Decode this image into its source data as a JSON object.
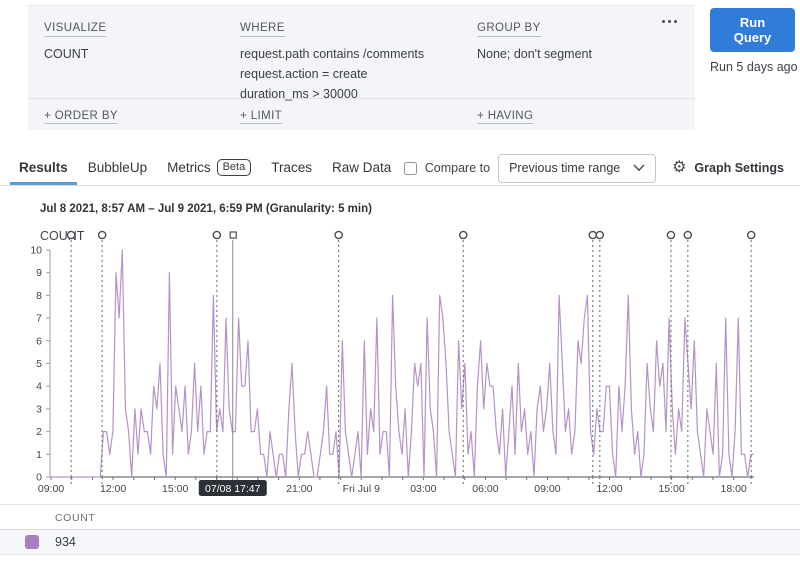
{
  "query_builder": {
    "visualize": {
      "label": "VISUALIZE",
      "value": "COUNT"
    },
    "where": {
      "label": "WHERE",
      "clauses": [
        "request.path contains /comments",
        "request.action = create",
        "duration_ms > 30000"
      ]
    },
    "group_by": {
      "label": "GROUP BY",
      "value": "None; don't segment"
    },
    "order_by_label": "+ ORDER BY",
    "limit_label": "+ LIMIT",
    "having_label": "+ HAVING",
    "run_button_label": "Run Query",
    "last_run_text": "Run 5 days ago"
  },
  "tabs": [
    {
      "label": "Results",
      "active": true
    },
    {
      "label": "BubbleUp",
      "active": false
    },
    {
      "label": "Metrics",
      "badge": "Beta",
      "active": false
    },
    {
      "label": "Traces",
      "active": false
    },
    {
      "label": "Raw Data",
      "active": false
    }
  ],
  "toolbar": {
    "compare_label": "Compare to",
    "compare_checked": false,
    "range_select_value": "Previous time range",
    "gear_glyph": "⚙",
    "graph_settings_label": "Graph Settings"
  },
  "chart_data": {
    "type": "line",
    "title": "Jul 8 2021, 8:57 AM – Jul 9 2021, 6:59 PM (Granularity: 5 min)",
    "ylabel": "COUNT",
    "ylim": [
      0,
      10
    ],
    "y_ticks": [
      0,
      1,
      2,
      3,
      4,
      5,
      6,
      7,
      8,
      9,
      10
    ],
    "x_range_minutes": 2042,
    "x_tick_interval_minutes": 60,
    "x_ticks": [
      {
        "label": "09:00",
        "f": 0.0015
      },
      {
        "label": "12:00",
        "f": 0.0896
      },
      {
        "label": "15:00",
        "f": 0.1778
      },
      {
        "label": "21:00",
        "f": 0.3541
      },
      {
        "label": "Fri Jul 9",
        "f": 0.4422
      },
      {
        "label": "03:00",
        "f": 0.5303
      },
      {
        "label": "06:00",
        "f": 0.6185
      },
      {
        "label": "09:00",
        "f": 0.7066
      },
      {
        "label": "12:00",
        "f": 0.7947
      },
      {
        "label": "15:00",
        "f": 0.8829
      },
      {
        "label": "18:00",
        "f": 0.9711
      }
    ],
    "grid": false,
    "legend_position": "none",
    "annotations_f": [
      0.03,
      0.074,
      0.237,
      0.41,
      0.587,
      0.771,
      0.781,
      0.882,
      0.906,
      0.996
    ],
    "crosshair": {
      "f": 0.2596,
      "label": "07/08 17:47"
    },
    "series": [
      {
        "name": "COUNT",
        "color": "#b593c8",
        "values": [
          0,
          0,
          0,
          0,
          0,
          0,
          0,
          0,
          0,
          0,
          0,
          0,
          0,
          0,
          0,
          0,
          0,
          2,
          2,
          1,
          2,
          9,
          7,
          10,
          3,
          2,
          0,
          3,
          1,
          3,
          2,
          2,
          1,
          4,
          3,
          5,
          1,
          0,
          9,
          1,
          4,
          3,
          2,
          4,
          1,
          2,
          5,
          2,
          4,
          1,
          2,
          2,
          8,
          2,
          3,
          2,
          7,
          3,
          2,
          2,
          7,
          4,
          4,
          6,
          2,
          2,
          3,
          1,
          1,
          0,
          2,
          1,
          0,
          1,
          1,
          0,
          3,
          5,
          2,
          0,
          1,
          1,
          2,
          1,
          0,
          0,
          1,
          2,
          4,
          1,
          1,
          2,
          0,
          6,
          2,
          1,
          0,
          1,
          2,
          0,
          6,
          1,
          3,
          2,
          7,
          1,
          2,
          2,
          0,
          8,
          4,
          2,
          1,
          3,
          0,
          2,
          5,
          4,
          5,
          0,
          7,
          3,
          2,
          0,
          8,
          7,
          5,
          2,
          1,
          0,
          6,
          3,
          5,
          1,
          2,
          0,
          4,
          6,
          3,
          5,
          4,
          4,
          2,
          1,
          3,
          0,
          2,
          4,
          1,
          5,
          2,
          3,
          1,
          2,
          0,
          3,
          4,
          2,
          3,
          5,
          2,
          1,
          8,
          5,
          2,
          3,
          1,
          2,
          6,
          5,
          7,
          8,
          2,
          1,
          3,
          2,
          2,
          4,
          4,
          1,
          0,
          4,
          2,
          4,
          8,
          3,
          1,
          2,
          0,
          1,
          5,
          3,
          2,
          6,
          4,
          5,
          2,
          7,
          3,
          1,
          3,
          2,
          7,
          5,
          3,
          6,
          2,
          1,
          0,
          3,
          2,
          1,
          5,
          0,
          1,
          7,
          1,
          0,
          2,
          7,
          1,
          1,
          0,
          1,
          1
        ]
      }
    ]
  },
  "summary_table": {
    "header": "COUNT",
    "rows": [
      {
        "swatch_color": "#a87fc0",
        "value": "934"
      }
    ]
  },
  "colors": {
    "accent_blue": "#2f7dd9",
    "tab_underline": "#5b9bd5",
    "series_purple": "#b593c8",
    "swatch_purple": "#a87fc0",
    "tooltip_bg": "#2c3037",
    "panel_bg": "#f4f5f8"
  }
}
